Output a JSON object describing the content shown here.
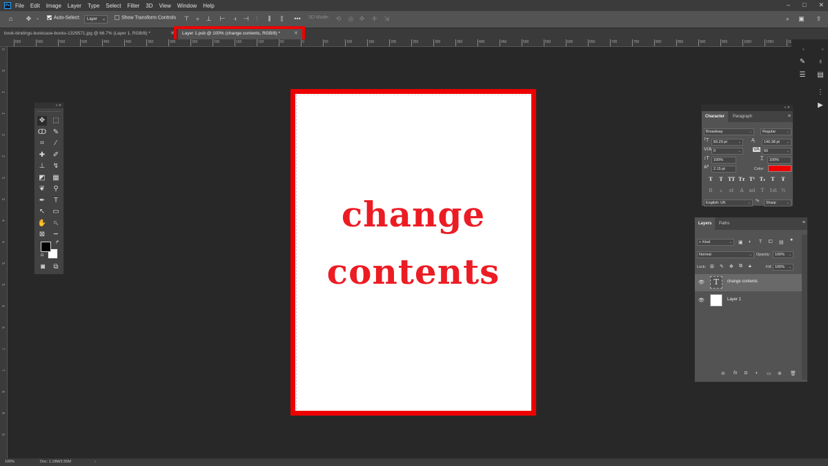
{
  "menubar": {
    "logo": "Ps",
    "items": [
      "File",
      "Edit",
      "Image",
      "Layer",
      "Type",
      "Select",
      "Filter",
      "3D",
      "View",
      "Window",
      "Help"
    ],
    "window_controls": [
      "–",
      "□",
      "✕"
    ]
  },
  "options_bar": {
    "auto_select_label": "Auto-Select:",
    "auto_select_checked": true,
    "auto_select_target": "Layer",
    "show_transform_label": "Show Transform Controls",
    "show_transform_checked": false,
    "more_label": "•••",
    "mode_3d_label": "3D Mode:"
  },
  "tabs": [
    {
      "label": "book-bindings-bookcase-books-1329571.jpg @ 66.7% (Layer 1, RGB/8) *",
      "active": false
    },
    {
      "label": "Layer 1.psb @ 100% (change contents, RGB/8) *",
      "active": true
    }
  ],
  "ruler": {
    "top_labels": [
      "650",
      "600",
      "550",
      "500",
      "450",
      "400",
      "350",
      "300",
      "250",
      "200",
      "150",
      "100",
      "50",
      "0",
      "50",
      "100",
      "150",
      "200",
      "250",
      "300",
      "350",
      "400",
      "450",
      "500",
      "550",
      "600",
      "650",
      "700",
      "750",
      "800",
      "850",
      "900",
      "950",
      "1000",
      "1050",
      "1100"
    ],
    "left_labels": [
      "0",
      "5",
      "1",
      "1",
      "2",
      "2",
      "3",
      "3",
      "4",
      "4",
      "5",
      "5",
      "6",
      "6",
      "7",
      "7",
      "8",
      "8",
      "9"
    ]
  },
  "canvas": {
    "line1": "change",
    "line2": "contents",
    "text_color": "#ec1c24",
    "highlight_color": "#ef0000"
  },
  "tools": [
    {
      "icon": "move-icon",
      "glyph": "✥"
    },
    {
      "icon": "marquee-icon",
      "glyph": "⬚"
    },
    {
      "icon": "lasso-icon",
      "glyph": "ↀ"
    },
    {
      "icon": "quick-select-icon",
      "glyph": "✎"
    },
    {
      "icon": "crop-icon",
      "glyph": "⌗"
    },
    {
      "icon": "eyedropper-icon",
      "glyph": "⁄"
    },
    {
      "icon": "healing-brush-icon",
      "glyph": "✚"
    },
    {
      "icon": "brush-icon",
      "glyph": "✐"
    },
    {
      "icon": "clone-stamp-icon",
      "glyph": "⊥"
    },
    {
      "icon": "history-brush-icon",
      "glyph": "↯"
    },
    {
      "icon": "eraser-icon",
      "glyph": "◩"
    },
    {
      "icon": "gradient-icon",
      "glyph": "▦"
    },
    {
      "icon": "blur-icon",
      "glyph": "❦"
    },
    {
      "icon": "dodge-icon",
      "glyph": "⚲"
    },
    {
      "icon": "pen-icon",
      "glyph": "✒"
    },
    {
      "icon": "type-icon",
      "glyph": "T"
    },
    {
      "icon": "path-select-icon",
      "glyph": "↖"
    },
    {
      "icon": "rectangle-icon",
      "glyph": "▭"
    },
    {
      "icon": "hand-icon",
      "glyph": "✋"
    },
    {
      "icon": "zoom-icon",
      "glyph": "🔍︎"
    },
    {
      "icon": "frame-icon",
      "glyph": "⊠"
    },
    {
      "icon": "more-tools-icon",
      "glyph": "•••"
    }
  ],
  "character_panel": {
    "tabs": [
      "Character",
      "Paragraph"
    ],
    "font_family": "Broadway",
    "font_style": "Regular",
    "font_size": "83.29 pt",
    "leading": "140.38 pt",
    "kerning": "0",
    "tracking": "60",
    "vertical_scale": "100%",
    "horizontal_scale": "100%",
    "baseline_shift": "2.15 pt",
    "color_label": "Color:",
    "color_value": "#ef0000",
    "language": "English: UK",
    "antialias": "Sharp",
    "type_buttons": [
      "T",
      "T",
      "TT",
      "Tт",
      "T¹",
      "T₁",
      "T",
      "Ŧ"
    ],
    "opentype_buttons": [
      "fi",
      "ℴ",
      "st",
      "A",
      "ad",
      "T",
      "1st",
      "½"
    ]
  },
  "layers_panel": {
    "tabs": [
      "Layers",
      "Paths"
    ],
    "filter_kind": "Kind",
    "blend_mode": "Normal",
    "opacity_label": "Opacity:",
    "opacity_value": "100%",
    "lock_label": "Lock:",
    "fill_label": "Fill:",
    "fill_value": "100%",
    "layers": [
      {
        "name": "change contents",
        "kind": "type",
        "visible": true,
        "selected": true
      },
      {
        "name": "Layer 1",
        "kind": "pixel",
        "visible": true,
        "selected": false
      }
    ]
  },
  "status_bar": {
    "zoom": "100%",
    "doc_info": "Doc: 1.18M/2.55M"
  }
}
